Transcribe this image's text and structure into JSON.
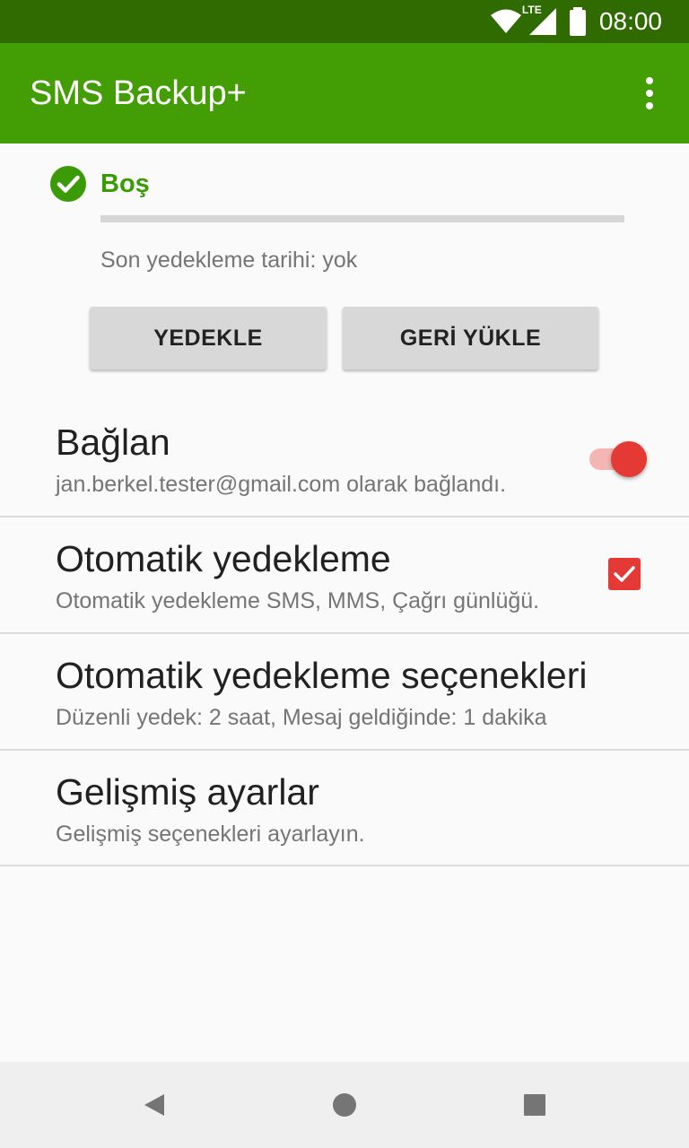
{
  "status_bar": {
    "time": "08:00",
    "network_label": "LTE",
    "icons": [
      "wifi-icon",
      "cell-signal-icon",
      "battery-icon"
    ]
  },
  "app_bar": {
    "title": "SMS Backup+",
    "menu_icon": "overflow-menu-icon"
  },
  "status": {
    "icon": "check-circle-icon",
    "text": "Boş",
    "progress": 0,
    "last_backup": "Son yedekleme tarihi: yok"
  },
  "actions": {
    "backup_label": "YEDEKLE",
    "restore_label": "GERİ YÜKLE"
  },
  "preferences": [
    {
      "title": "Bağlan",
      "summary": "jan.berkel.tester@gmail.com olarak bağlandı.",
      "widget": "switch",
      "checked": true
    },
    {
      "title": "Otomatik yedekleme",
      "summary": "Otomatik yedekleme SMS, MMS, Çağrı günlüğü.",
      "widget": "checkbox",
      "checked": true
    },
    {
      "title": "Otomatik yedekleme seçenekleri",
      "summary": "Düzenli yedek: 2 saat, Mesaj geldiğinde: 1 dakika"
    },
    {
      "title": "Gelişmiş ayarlar",
      "summary": "Gelişmiş seçenekleri ayarlayın."
    }
  ],
  "nav_bar": {
    "icons": [
      "back-icon",
      "home-icon",
      "recents-icon"
    ]
  },
  "colors": {
    "status_bar": "#2f6b00",
    "app_bar": "#429e04",
    "status_text": "#3a9b06",
    "accent": "#e53935"
  }
}
